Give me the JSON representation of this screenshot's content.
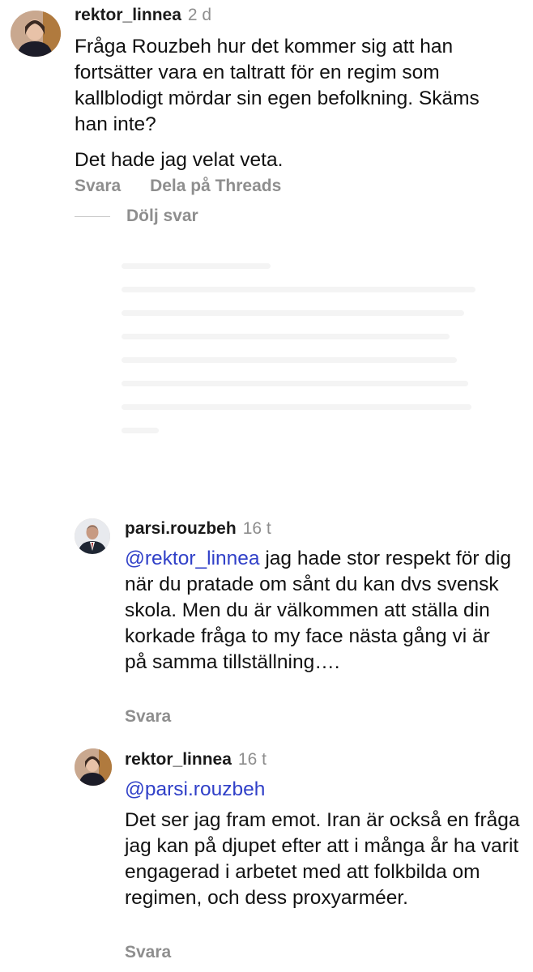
{
  "comments": [
    {
      "username": "rektor_linnea",
      "time": "2 d",
      "paragraphs": [
        "Fråga Rouzbeh hur det kommer sig att han fortsätter vara en taltratt för en regim som kallblodigt mördar sin egen befolkning. Skäms han inte?",
        "Det hade jag velat veta."
      ],
      "reply_label": "Svara",
      "share_label": "Dela på Threads"
    },
    {
      "username": "parsi.rouzbeh",
      "time": "16 t",
      "mention": "@rektor_linnea",
      "text": " jag hade stor respekt för dig när du pratade om sånt du kan dvs svensk skola. Men du är välkommen att ställa din korkade fråga to my face nästa gång vi är på samma tillställning….",
      "reply_label": "Svara"
    },
    {
      "username": "rektor_linnea",
      "time": "16 t",
      "mention": "@parsi.rouzbeh",
      "text": "Det ser jag fram emot. Iran är också en fråga jag kan på djupet efter att i många år ha varit engagerad i arbetet med att folkbilda om regimen, och dess proxyarméer.",
      "reply_label": "Svara"
    }
  ],
  "hide_replies_label": "Dölj svar"
}
